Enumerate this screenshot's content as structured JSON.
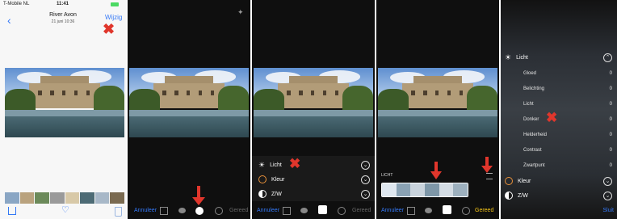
{
  "panel1": {
    "status": {
      "carrier": "T-Mobile NL",
      "time": "11:41"
    },
    "title": "River Avon",
    "subtitle": "21 juni  10:36",
    "edit_label": "Wijzig"
  },
  "panel2": {},
  "panel3": {
    "rows": [
      {
        "label": "Licht"
      },
      {
        "label": "Kleur"
      },
      {
        "label": "Z/W"
      }
    ],
    "cancel_label": "Annuleer",
    "done_label": "Gereed"
  },
  "panel4": {
    "section_label": "LICHT",
    "cancel_label": "Annuleer",
    "done_label": "Gereed"
  },
  "panel5": {
    "header_label": "Licht",
    "sliders": [
      {
        "label": "Gloed",
        "value": "0"
      },
      {
        "label": "Belichting",
        "value": "0"
      },
      {
        "label": "Licht",
        "value": "0"
      },
      {
        "label": "Donker",
        "value": "0"
      },
      {
        "label": "Helderheid",
        "value": "0"
      },
      {
        "label": "Contrast",
        "value": "0"
      },
      {
        "label": "Zwartpunt",
        "value": "0"
      }
    ],
    "other_rows": [
      {
        "label": "Kleur"
      },
      {
        "label": "Z/W"
      }
    ],
    "close_label": "Sluit"
  },
  "colors": {
    "accent": "#3478f6",
    "done_yellow": "#f5c518",
    "marker_red": "#e0362c"
  },
  "icons": [
    "back-chevron-icon",
    "share-icon",
    "heart-icon",
    "trash-icon",
    "crop-icon",
    "filters-icon",
    "adjust-icon",
    "more-icon",
    "magic-wand-icon",
    "list-icon",
    "sun-icon",
    "color-icon",
    "bw-icon",
    "arrow-down-icon",
    "x-marker-icon"
  ]
}
